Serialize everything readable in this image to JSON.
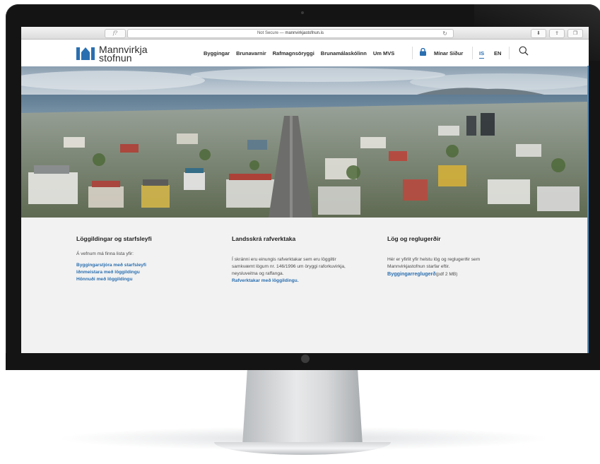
{
  "browser": {
    "tab_button": "f?",
    "address_prefix": "Not Secure — ",
    "address_url": "mannvirkjastofnun.is"
  },
  "header": {
    "logo_line1": "Mannvirkja",
    "logo_line2": "stofnun",
    "nav": [
      "Byggingar",
      "Brunavarnir",
      "Rafmagnsöryggi",
      "Brunamálaskólinn",
      "Um MVS"
    ],
    "my_pages": "Mínar Síður",
    "lang_is": "IS",
    "lang_en": "EN"
  },
  "columns": [
    {
      "heading": "Löggildingar og starfsleyfi",
      "intro": "Á vefnum má finna lista yfir:",
      "links": [
        "Byggingarstjóra með starfsleyfi",
        "Iðnmeistara með löggildingu",
        "Hönnuði með löggildingu"
      ]
    },
    {
      "heading": "Landsskrá rafverktaka",
      "text_lines": [
        "Í skránni eru einungis rafverktakar sem eru löggiltir",
        "samkvæmt lögum nr. 146/1996 um öryggi raforkuvirkja,",
        "neysluveitna og raffanga."
      ],
      "link": "Rafverktakar með löggildingu."
    },
    {
      "heading": "Lög og reglugerðir",
      "text_lines": [
        "Hér er yfirlit yfir helstu lög og reglugerðir sem",
        "Mannvirkjastofnun starfar eftir."
      ],
      "link": "Byggingarreglugerð",
      "link_suffix": "(pdf 2 MB)"
    }
  ],
  "colors": {
    "brand_blue": "#2a6fb0",
    "bezel": "#141414"
  }
}
